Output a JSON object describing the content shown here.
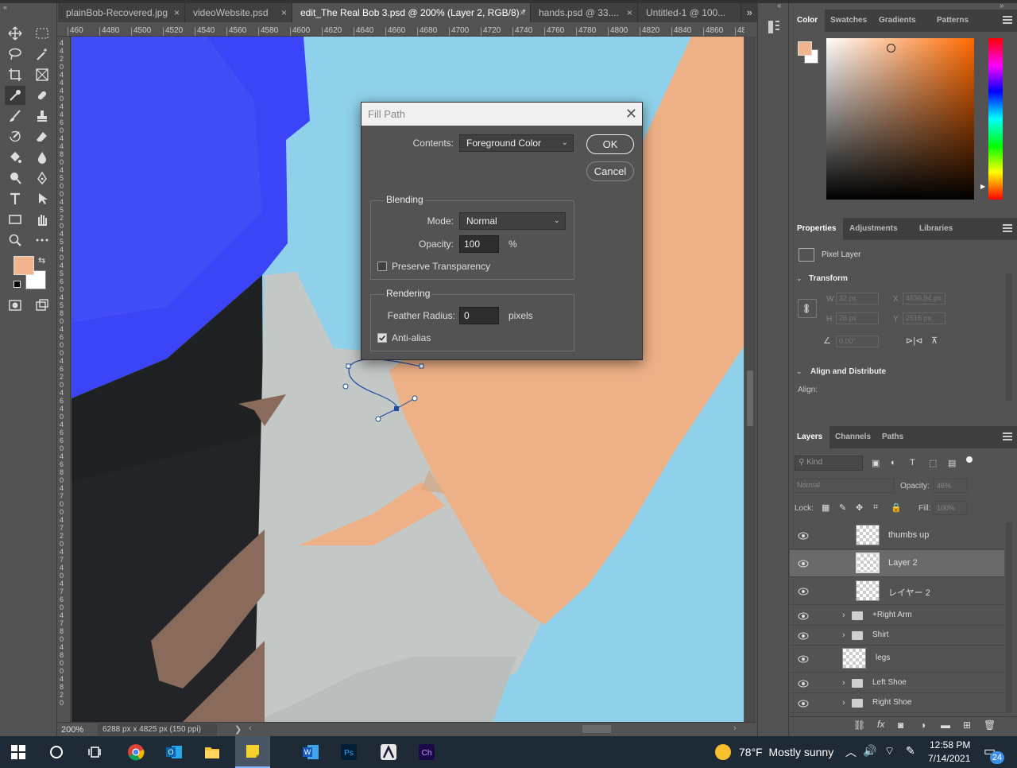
{
  "tabs": [
    {
      "label": "plainBob-Recovered.jpg"
    },
    {
      "label": "videoWebsite.psd"
    },
    {
      "label": "edit_The Real Bob 3.psd @ 200% (Layer 2, RGB/8) *"
    },
    {
      "label": "hands.psd @ 33...."
    },
    {
      "label": "Untitled-1 @ 100..."
    }
  ],
  "tab_close": "×",
  "tab_overflow": "»",
  "ruler_top": [
    "460",
    "4480",
    "4500",
    "4520",
    "4540",
    "4560",
    "4580",
    "4600",
    "4620",
    "4640",
    "4660",
    "4680",
    "4700",
    "4720",
    "4740",
    "4760",
    "4780",
    "4800",
    "4820",
    "4840",
    "4860",
    "48"
  ],
  "ruler_left": [
    "4",
    "4",
    "2",
    "0",
    "4",
    "4",
    "4",
    "0",
    "4",
    "4",
    "6",
    "0",
    "4",
    "4",
    "8",
    "0",
    "4",
    "5",
    "0",
    "0",
    "4",
    "5",
    "2",
    "0",
    "4",
    "5",
    "4",
    "0",
    "4",
    "5",
    "6",
    "0",
    "4",
    "5",
    "8",
    "0",
    "4",
    "6",
    "0",
    "0",
    "4",
    "6",
    "2",
    "0",
    "4",
    "6",
    "4",
    "0",
    "4",
    "6",
    "6",
    "0",
    "4",
    "6",
    "8",
    "0",
    "4",
    "7",
    "0",
    "0",
    "4",
    "7",
    "2",
    "0",
    "4",
    "7",
    "4",
    "0",
    "4",
    "7",
    "6",
    "0",
    "4",
    "7",
    "8",
    "0",
    "4",
    "8",
    "0",
    "0",
    "4",
    "8",
    "2",
    "0"
  ],
  "status": {
    "zoom": "200%",
    "doc_info": "6288 px x 4825 px (150 ppi)",
    "arrow": "❯"
  },
  "colors": {
    "foreground": "#f2b48c",
    "background": "#ffffff",
    "skin": "#eeb087",
    "sky": "#8fd1ea",
    "shirt": "#3b44f6"
  },
  "dialog": {
    "title": "Fill Path",
    "close": "✕",
    "contents_label": "Contents:",
    "contents_value": "Foreground Color",
    "ok": "OK",
    "cancel": "Cancel",
    "blending_title": "Blending",
    "mode_label": "Mode:",
    "mode_value": "Normal",
    "opacity_label": "Opacity:",
    "opacity_value": "100",
    "opacity_unit": "%",
    "preserve_label": "Preserve Transparency",
    "preserve_checked": false,
    "rendering_title": "Rendering",
    "feather_label": "Feather Radius:",
    "feather_value": "0",
    "feather_unit": "pixels",
    "antialias_label": "Anti-alias",
    "antialias_checked": true
  },
  "color_panel": {
    "tabs": [
      "Color",
      "Swatches",
      "Gradients",
      "Patterns"
    ]
  },
  "properties_panel": {
    "tabs": [
      "Properties",
      "Adjustments",
      "Libraries"
    ],
    "kind": "Pixel Layer",
    "transform_title": "Transform",
    "w_label": "W",
    "w_value": "32 px",
    "h_label": "H",
    "h_value": "26 px",
    "x_label": "X",
    "x_value": "4636.94 px",
    "y_label": "Y",
    "y_value": "2616 px",
    "angle_value": "0.00°",
    "align_title": "Align and Distribute",
    "align_label": "Align:"
  },
  "layers_panel": {
    "tabs": [
      "Layers",
      "Channels",
      "Paths"
    ],
    "filter_placeholder": "Kind",
    "blend_mode": "Normal",
    "opacity_label": "Opacity:",
    "opacity_value": "46%",
    "lock_label": "Lock:",
    "fill_label": "Fill:",
    "fill_value": "100%",
    "layers": [
      {
        "name": "thumbs up",
        "type": "pixel",
        "selected": false
      },
      {
        "name": "Layer 2",
        "type": "pixel",
        "selected": true
      },
      {
        "name": "レイヤー 2",
        "type": "pixel",
        "selected": false
      },
      {
        "name": "+Right Arm",
        "type": "group",
        "selected": false
      },
      {
        "name": "Shirt",
        "type": "group",
        "selected": false
      },
      {
        "name": "legs",
        "type": "pixel-small",
        "selected": false
      },
      {
        "name": "Left Shoe",
        "type": "group",
        "selected": false
      },
      {
        "name": "Right Shoe",
        "type": "group",
        "selected": false
      }
    ]
  },
  "taskbar": {
    "weather": "78°F  Mostly sunny",
    "time": "12:58 PM",
    "date": "7/14/2021",
    "notifications": "24",
    "icons": [
      "windows-start-icon",
      "cortana-icon",
      "task-view-icon",
      "chrome-icon",
      "outlook-icon",
      "file-explorer-icon",
      "sticky-notes-icon",
      "word-icon",
      "photoshop-icon",
      "character-animator-app-icon",
      "character-animator-icon"
    ]
  }
}
